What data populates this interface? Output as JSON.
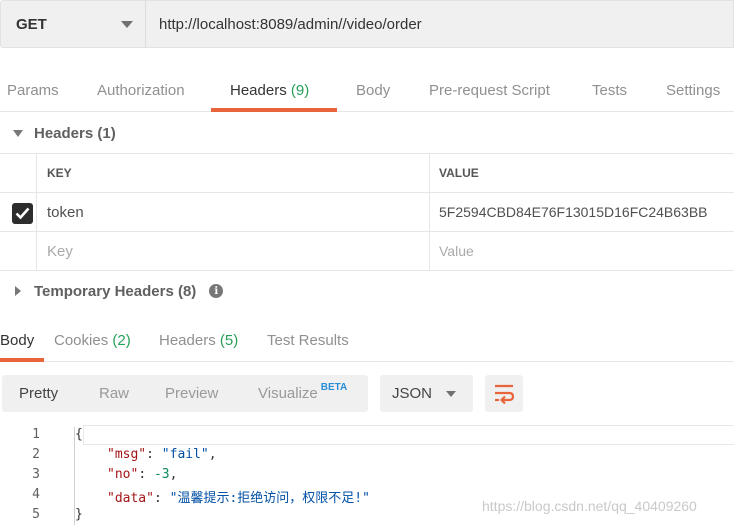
{
  "request": {
    "method": "GET",
    "url": "http://localhost:8089/admin//video/order"
  },
  "request_tabs": [
    {
      "label": "Params",
      "count": "",
      "active": false
    },
    {
      "label": "Authorization",
      "count": "",
      "active": false
    },
    {
      "label": "Headers",
      "count": "(9)",
      "active": true
    },
    {
      "label": "Body",
      "count": "",
      "active": false
    },
    {
      "label": "Pre-request Script",
      "count": "",
      "active": false
    },
    {
      "label": "Tests",
      "count": "",
      "active": false
    },
    {
      "label": "Settings",
      "count": "",
      "active": false
    }
  ],
  "headers_section": {
    "title": "Headers",
    "count": "(1)",
    "columns": {
      "key": "KEY",
      "value": "VALUE"
    },
    "rows": [
      {
        "checked": true,
        "key": "token",
        "value": "5F2594CBD84E76F13015D16FC24B63BB"
      }
    ],
    "new_row": {
      "key_placeholder": "Key",
      "value_placeholder": "Value"
    }
  },
  "temporary_headers": {
    "title": "Temporary Headers",
    "count": "(8)",
    "icon": "info-icon"
  },
  "response_tabs": [
    {
      "label": "Body",
      "count": "",
      "active": true
    },
    {
      "label": "Cookies",
      "count": "(2)",
      "active": false
    },
    {
      "label": "Headers",
      "count": "(5)",
      "active": false
    },
    {
      "label": "Test Results",
      "count": "",
      "active": false
    }
  ],
  "response_toolbar": {
    "views": [
      "Pretty",
      "Raw",
      "Preview",
      "Visualize"
    ],
    "beta_badge": "BETA",
    "format": "JSON",
    "wrap_icon": "wrap-lines-icon"
  },
  "response_body": {
    "line_numbers": [
      "1",
      "2",
      "3",
      "4",
      "5"
    ],
    "lines": [
      {
        "open": "{"
      },
      {
        "key": "\"msg\"",
        "sep": ": ",
        "value": "\"fail\"",
        "end": ","
      },
      {
        "key": "\"no\"",
        "sep": ": ",
        "value": "-3",
        "end": ","
      },
      {
        "key": "\"data\"",
        "sep": ": ",
        "value": "\"温馨提示:拒绝访问，权限不足!\"",
        "end": ""
      },
      {
        "close": "}"
      }
    ]
  },
  "watermark": "https://blog.csdn.net/qq_40409260",
  "colors": {
    "accent": "#e8643a",
    "count_green": "#28a05a",
    "beta_blue": "#2a8fd6"
  }
}
